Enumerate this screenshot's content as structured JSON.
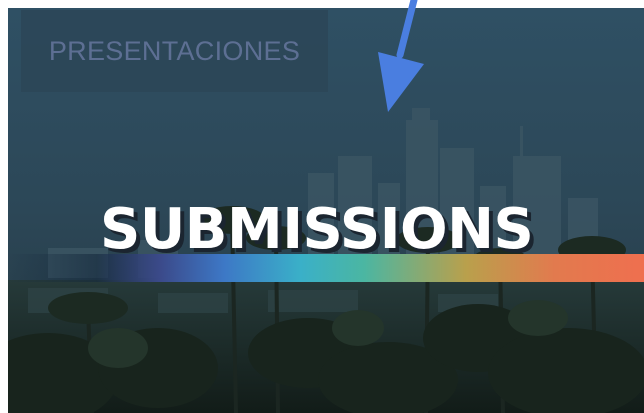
{
  "hero": {
    "tag_label": "PRESENTACIONES",
    "headline": "SUBMISSIONS"
  },
  "colors": {
    "arrow": "#4a7ee0",
    "tag_background": "#2c4658",
    "tag_text": "#5d6f93",
    "headline_text": "#ffffff",
    "stripe_start": "#3b4a8a",
    "stripe_mid": "#3ab0c8",
    "stripe_end": "#ef6f4f"
  },
  "icons": {
    "pointer": "arrow-down-icon"
  }
}
